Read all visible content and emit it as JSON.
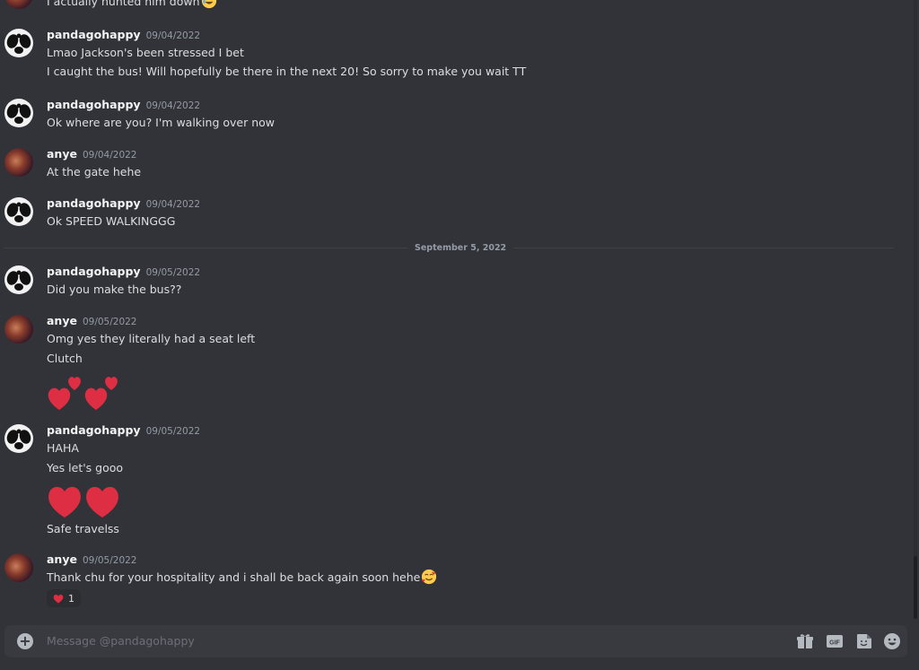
{
  "partial_message": {
    "text": "I actually hunted him down",
    "emoji": "rofl-emoji"
  },
  "messages": [
    {
      "user": "pandagohappy",
      "date": "09/04/2022",
      "lines": [
        "Lmao Jackson's been stressed I bet",
        "I caught the bus! Will hopefully be there in the next 20! So sorry to make you wait TT"
      ]
    },
    {
      "user": "pandagohappy",
      "date": "09/04/2022",
      "lines": [
        "Ok where are you? I'm walking over now"
      ]
    },
    {
      "user": "anye",
      "date": "09/04/2022",
      "lines": [
        "At the gate hehe"
      ]
    },
    {
      "user": "pandagohappy",
      "date": "09/04/2022",
      "lines": [
        "Ok SPEED WALKINGGG"
      ]
    },
    {
      "user": "pandagohappy",
      "date": "09/05/2022",
      "lines": [
        "Did you make the bus??"
      ]
    },
    {
      "user": "anye",
      "date": "09/05/2022",
      "lines": [
        "Omg yes they literally had a seat left",
        "Clutch"
      ],
      "big_emoji": [
        "two-hearts-emoji",
        "two-hearts-emoji"
      ]
    },
    {
      "user": "pandagohappy",
      "date": "09/05/2022",
      "lines": [
        "HAHA",
        "Yes let's gooo",
        "Safe travelss"
      ],
      "big_emoji": [
        "red-heart-emoji",
        "red-heart-emoji"
      ]
    },
    {
      "user": "anye",
      "date": "09/05/2022",
      "lines": [
        "Thank chu for your hospitality and i shall be back again soon hehe"
      ],
      "inline_emoji": "smiling-face-with-hearts-emoji",
      "reaction": {
        "emoji": "red-heart-emoji",
        "count": "1"
      }
    }
  ],
  "date_divider": "September 5, 2022",
  "composer": {
    "placeholder": "Message @pandagohappy",
    "icons": [
      "add-attachment-icon",
      "gift-icon",
      "gif-icon",
      "sticker-icon",
      "emoji-icon"
    ]
  },
  "colors": {
    "background": "#313338",
    "username": "#f2f3f5",
    "timestamp": "#949ba4",
    "composer": "#383a40",
    "heart": "#dd2e44"
  }
}
